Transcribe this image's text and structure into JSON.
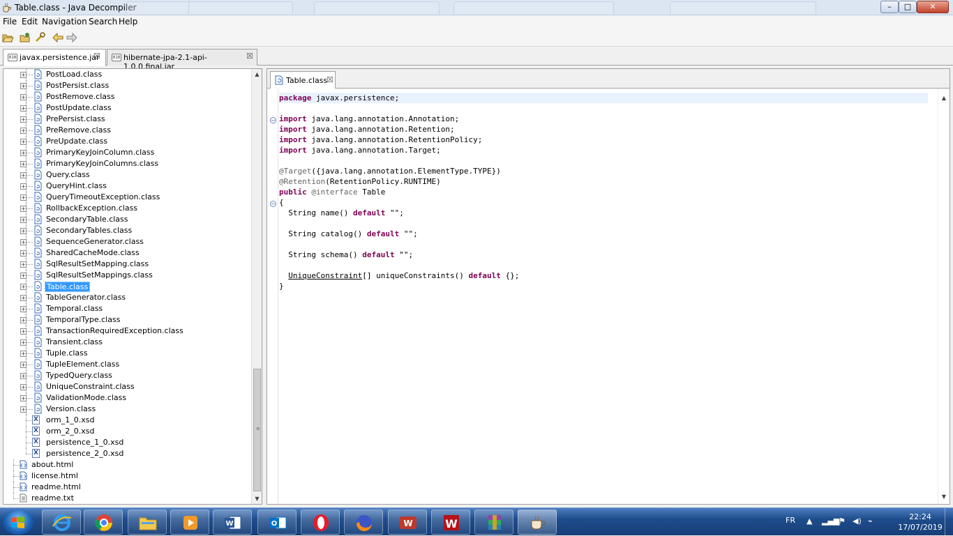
{
  "window": {
    "title": "Table.class - Java Decompiler",
    "min_label": "–",
    "max_label": "□",
    "close_label": "✕"
  },
  "menu": [
    "File",
    "Edit",
    "Navigation",
    "Search",
    "Help"
  ],
  "toolbar": {
    "icons": [
      "open-file-icon",
      "open-type-icon",
      "find-icon",
      "back-icon",
      "forward-icon"
    ]
  },
  "jar_tabs": [
    {
      "label": "javax.persistence.jar",
      "icon_text": "010",
      "close": "☒",
      "active": true
    },
    {
      "label": "hibernate-jpa-2.1-api-1.0.0.final.jar",
      "icon_text": "010",
      "close": "☒",
      "active": false
    }
  ],
  "tree": {
    "classes": [
      "PostLoad.class",
      "PostPersist.class",
      "PostRemove.class",
      "PostUpdate.class",
      "PrePersist.class",
      "PreRemove.class",
      "PreUpdate.class",
      "PrimaryKeyJoinColumn.class",
      "PrimaryKeyJoinColumns.class",
      "Query.class",
      "QueryHint.class",
      "QueryTimeoutException.class",
      "RollbackException.class",
      "SecondaryTable.class",
      "SecondaryTables.class",
      "SequenceGenerator.class",
      "SharedCacheMode.class",
      "SqlResultSetMapping.class",
      "SqlResultSetMappings.class",
      "Table.class",
      "TableGenerator.class",
      "Temporal.class",
      "TemporalType.class",
      "TransactionRequiredException.class",
      "Transient.class",
      "Tuple.class",
      "TupleElement.class",
      "TypedQuery.class",
      "UniqueConstraint.class",
      "ValidationMode.class",
      "Version.class"
    ],
    "selected": "Table.class",
    "expander": "+",
    "xsd_icon": "X",
    "xsd_files": [
      "orm_1_0.xsd",
      "orm_2_0.xsd",
      "persistence_1_0.xsd",
      "persistence_2_0.xsd"
    ],
    "root_files": [
      {
        "label": "about.html",
        "icon": "html-file-icon"
      },
      {
        "label": "license.html",
        "icon": "html-file-icon"
      },
      {
        "label": "readme.html",
        "icon": "html-file-icon"
      },
      {
        "label": "readme.txt",
        "icon": "text-file-icon"
      }
    ]
  },
  "editor": {
    "tab_label": "Table.class",
    "tab_close": "☒",
    "fold_marker": "−",
    "lines": [
      [
        {
          "t": "package",
          "c": "kw"
        },
        {
          "t": " javax.persistence;"
        }
      ],
      [],
      [
        {
          "t": "import",
          "c": "kw"
        },
        {
          "t": " java.lang.annotation.Annotation;"
        }
      ],
      [
        {
          "t": "import",
          "c": "kw"
        },
        {
          "t": " java.lang.annotation.Retention;"
        }
      ],
      [
        {
          "t": "import",
          "c": "kw"
        },
        {
          "t": " java.lang.annotation.RetentionPolicy;"
        }
      ],
      [
        {
          "t": "import",
          "c": "kw"
        },
        {
          "t": " java.lang.annotation.Target;"
        }
      ],
      [],
      [
        {
          "t": "@Target",
          "c": "ann"
        },
        {
          "t": "({java.lang.annotation.ElementType.TYPE})"
        }
      ],
      [
        {
          "t": "@Retention",
          "c": "ann"
        },
        {
          "t": "(RetentionPolicy.RUNTIME)"
        }
      ],
      [
        {
          "t": "public",
          "c": "kw"
        },
        {
          "t": " "
        },
        {
          "t": "@interface",
          "c": "ann"
        },
        {
          "t": " Table"
        }
      ],
      [
        {
          "t": "{"
        }
      ],
      [
        {
          "t": "  String name() "
        },
        {
          "t": "default",
          "c": "kw"
        },
        {
          "t": " \"\";"
        }
      ],
      [],
      [
        {
          "t": "  String catalog() "
        },
        {
          "t": "default",
          "c": "kw"
        },
        {
          "t": " \"\";"
        }
      ],
      [],
      [
        {
          "t": "  String schema() "
        },
        {
          "t": "default",
          "c": "kw"
        },
        {
          "t": " \"\";"
        }
      ],
      [],
      [
        {
          "t": "  "
        },
        {
          "t": "UniqueConstraint",
          "c": "ul"
        },
        {
          "t": "[] uniqueConstraints() "
        },
        {
          "t": "default",
          "c": "kw"
        },
        {
          "t": " {};"
        }
      ],
      [
        {
          "t": "}"
        }
      ]
    ]
  },
  "taskbar": {
    "apps": [
      "internet-explorer-icon",
      "chrome-icon",
      "file-explorer-icon",
      "media-player-icon",
      "word-icon",
      "outlook-icon",
      "opera-icon",
      "firefox-icon",
      "winamax-poker-icon",
      "winamax-icon",
      "winrar-icon",
      "java-decompiler-icon"
    ],
    "lang": "FR",
    "time": "22:24",
    "date": "17/07/2019"
  },
  "colors": {
    "keyword": "#7f0055",
    "annotation": "#646464",
    "selection": "#3399ff",
    "current_line": "#e8f2fe"
  }
}
